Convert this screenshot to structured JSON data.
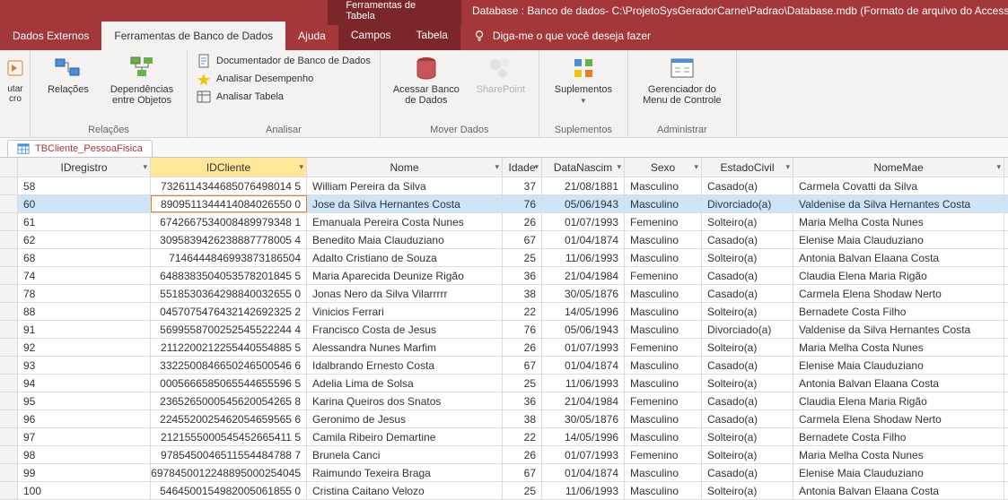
{
  "titlebar": {
    "tool_context": "Ferramentas de Tabela",
    "db_title": "Database : Banco de dados- C:\\ProjetoSysGeradorCarne\\Padrao\\Database.mdb (Formato de arquivo do Access..."
  },
  "menubar": {
    "dados_externos": "Dados Externos",
    "ferramentas_bd": "Ferramentas de Banco de Dados",
    "ajuda": "Ajuda",
    "campos": "Campos",
    "tabela": "Tabela",
    "tellme": "Diga-me o que você deseja fazer"
  },
  "ribbon": {
    "utar_cro": "utar\ncro",
    "relacoes": "Relações",
    "dependencias": "Dependências\nentre Objetos",
    "grp_relacoes": "Relações",
    "documentador": "Documentador de Banco de Dados",
    "analisar_desempenho": "Analisar Desempenho",
    "analisar_tabela": "Analisar Tabela",
    "grp_analisar": "Analisar",
    "acessar_bd": "Acessar Banco\nde Dados",
    "sharepoint": "SharePoint",
    "grp_mover": "Mover Dados",
    "suplementos": "Suplementos",
    "grp_suplementos": "Suplementos",
    "gerenciador": "Gerenciador do\nMenu de Controle",
    "grp_administrar": "Administrar"
  },
  "doc_tab": "TBCliente_PessoaFisica",
  "columns": {
    "idregistro": "IDregistro",
    "idcliente": "IDCliente",
    "nome": "Nome",
    "idade": "Idade",
    "datanascim": "DataNascim",
    "sexo": "Sexo",
    "estadocivil": "EstadoCivil",
    "nomemae": "NomeMae"
  },
  "rows": [
    {
      "id": "58",
      "cli": "7326114344685076498014 5",
      "nome": "William Pereira da Silva",
      "idade": "37",
      "nasc": "21/08/1881",
      "sexo": "Masculino",
      "civil": "Casado(a)",
      "mae": "Carmela Covatti  da Silva"
    },
    {
      "id": "60",
      "cli": "8909511344414084026550 0",
      "nome": "Jose da Silva Hernantes Costa",
      "idade": "76",
      "nasc": "05/06/1943",
      "sexo": "Masculino",
      "civil": "Divorciado(a)",
      "mae": "Valdenise da Silva Hernantes Costa",
      "selected": true
    },
    {
      "id": "61",
      "cli": "6742667534008489979348 1",
      "nome": "Emanuala Pereira Costa Nunes",
      "idade": "26",
      "nasc": "01/07/1993",
      "sexo": "Femenino",
      "civil": "Solteiro(a)",
      "mae": "Maria Melha Costa Nunes"
    },
    {
      "id": "62",
      "cli": "3095839426238887778005 4",
      "nome": "Benedito Maia Clauduziano",
      "idade": "67",
      "nasc": "01/04/1874",
      "sexo": "Masculino",
      "civil": "Casado(a)",
      "mae": "Elenise Maia Clauduziano"
    },
    {
      "id": "68",
      "cli": "7146444846993873186504",
      "nome": "Adalto Cristiano de Souza",
      "idade": "25",
      "nasc": "11/06/1993",
      "sexo": "Masculino",
      "civil": "Solteiro(a)",
      "mae": "Antonia Balvan Elaana Costa"
    },
    {
      "id": "74",
      "cli": "6488383504053578201845 5",
      "nome": "Maria Aparecida Deunize Rigão",
      "idade": "36",
      "nasc": "21/04/1984",
      "sexo": "Femenino",
      "civil": "Casado(a)",
      "mae": "Claudia Elena Maria Rigão"
    },
    {
      "id": "78",
      "cli": "5518530364298840032655 0",
      "nome": "Jonas Nero da Silva Vilarrrrr",
      "idade": "38",
      "nasc": "30/05/1876",
      "sexo": "Masculino",
      "civil": "Casado(a)",
      "mae": "Carmela Elena Shodaw Nerto"
    },
    {
      "id": "88",
      "cli": "0457075476432142692325 2",
      "nome": "Vinicios Ferrari",
      "idade": "22",
      "nasc": "14/05/1996",
      "sexo": "Masculino",
      "civil": "Solteiro(a)",
      "mae": "Bernadete Costa Filho"
    },
    {
      "id": "91",
      "cli": "5699558700252545522244 4",
      "nome": "Francisco Costa de Jesus",
      "idade": "76",
      "nasc": "05/06/1943",
      "sexo": "Masculino",
      "civil": "Divorciado(a)",
      "mae": "Valdenise da Silva Hernantes Costa"
    },
    {
      "id": "92",
      "cli": "2112200212255440554885 5",
      "nome": "Alessandra Nunes Marfim",
      "idade": "26",
      "nasc": "01/07/1993",
      "sexo": "Femenino",
      "civil": "Solteiro(a)",
      "mae": "Maria Melha Costa Nunes"
    },
    {
      "id": "93",
      "cli": "3322500846650246500546 6",
      "nome": "Idalbrando Ernesto Costa",
      "idade": "67",
      "nasc": "01/04/1874",
      "sexo": "Masculino",
      "civil": "Casado(a)",
      "mae": "Elenise Maia Clauduziano"
    },
    {
      "id": "94",
      "cli": "0005666585065544655596 5",
      "nome": "Adelia Lima de Solsa",
      "idade": "25",
      "nasc": "11/06/1993",
      "sexo": "Masculino",
      "civil": "Solteiro(a)",
      "mae": "Antonia Balvan Elaana Costa"
    },
    {
      "id": "95",
      "cli": "2365265000545620054265 8",
      "nome": "Karina Queiros dos Snatos",
      "idade": "36",
      "nasc": "21/04/1984",
      "sexo": "Femenino",
      "civil": "Casado(a)",
      "mae": "Claudia Elena Maria Rigão"
    },
    {
      "id": "96",
      "cli": "2245520025462054659565 6",
      "nome": "Geronimo de Jesus",
      "idade": "38",
      "nasc": "30/05/1876",
      "sexo": "Masculino",
      "civil": "Casado(a)",
      "mae": "Carmela Elena Shodaw Nerto"
    },
    {
      "id": "97",
      "cli": "2121555000545452665411 5",
      "nome": "Camila Ribeiro Demartine",
      "idade": "22",
      "nasc": "14/05/1996",
      "sexo": "Masculino",
      "civil": "Solteiro(a)",
      "mae": "Bernadete Costa Filho"
    },
    {
      "id": "98",
      "cli": "9785450046511554484788 7",
      "nome": "Brunela Canci",
      "idade": "26",
      "nasc": "01/07/1993",
      "sexo": "Femenino",
      "civil": "Solteiro(a)",
      "mae": "Maria Melha Costa Nunes"
    },
    {
      "id": "99",
      "cli": "6978450012248895000254045",
      "nome": "Raimundo Texeira Braga",
      "idade": "67",
      "nasc": "01/04/1874",
      "sexo": "Masculino",
      "civil": "Casado(a)",
      "mae": "Elenise Maia Clauduziano"
    },
    {
      "id": "100",
      "cli": "5464500154982005061855 0",
      "nome": "Cristina Caitano Velozo",
      "idade": "25",
      "nasc": "11/06/1993",
      "sexo": "Masculino",
      "civil": "Solteiro(a)",
      "mae": "Antonia Balvan Elaana Costa"
    }
  ]
}
